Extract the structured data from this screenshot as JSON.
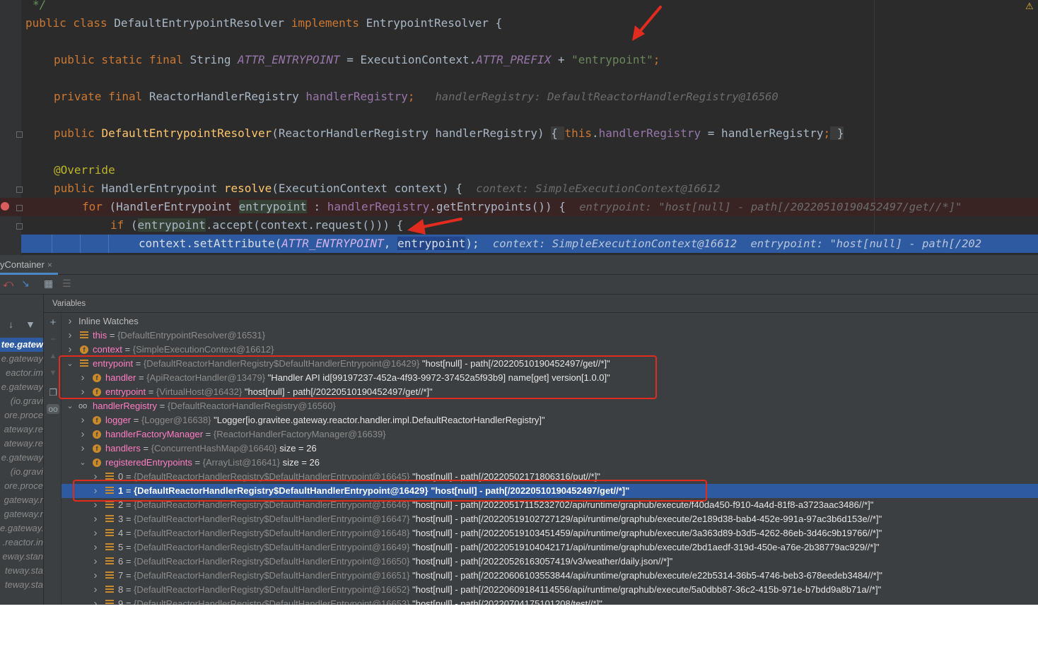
{
  "editor": {
    "comment_end": "*/",
    "lines": {
      "class_decl": {
        "kw1": "public class ",
        "name": "DefaultEntrypointResolver",
        "kw2": " implements ",
        "iface": "EntrypointResolver {"
      },
      "attr_field": {
        "kw": "public static final ",
        "type": "String ",
        "name": "ATTR_ENTRYPOINT",
        "mid": " = ExecutionContext.",
        "prefix": "ATTR_PREFIX",
        "plus": " + ",
        "str": "\"entrypoint\"",
        "end": ";"
      },
      "registry_field": {
        "kw": "private final ",
        "type": "ReactorHandlerRegistry ",
        "name": "handlerRegistry",
        "end": ";",
        "hint": "handlerRegistry: DefaultReactorHandlerRegistry@16560"
      },
      "constructor": {
        "kw": "public ",
        "name": "DefaultEntrypointResolver",
        "params": "(ReactorHandlerRegistry handlerRegistry) ",
        "ob": "{ ",
        "this_kw": "this",
        "dot": ".",
        "fld": "handlerRegistry",
        "assign": " = handlerRegistry",
        "semi": ";",
        "cb": " }"
      },
      "override": "@Override",
      "resolve": {
        "kw": "public ",
        "type": "HandlerEntrypoint ",
        "name": "resolve",
        "params": "(ExecutionContext context) {",
        "hint": "context: SimpleExecutionContext@16612"
      },
      "for_loop": {
        "kw": "for ",
        "open": "(HandlerEntrypoint ",
        "var": "entrypoint",
        "colon": " : ",
        "fld": "handlerRegistry",
        "call": ".getEntrypoints()) {",
        "hint": "entrypoint: \"host[null] - path[/20220510190452497/get//*]\""
      },
      "if_stmt": {
        "kw": "if ",
        "open": "(",
        "var": "entrypoint",
        "rest": ".accept(context.request())) {"
      },
      "exec": {
        "pre": "context.setAttribute(",
        "const": "ATTR_ENTRYPOINT",
        "comma": ", ",
        "var": "entrypoint",
        "end": ");",
        "hint1": "context: SimpleExecutionContext@16612",
        "hint2": "entrypoint: \"host[null] - path[/202"
      }
    }
  },
  "debugger": {
    "tab_label": "yContainer",
    "tab_close": "×",
    "variables_label": "Variables",
    "frames": [
      {
        "label": "tee.gatew",
        "selected": true
      },
      {
        "label": "e.gateway"
      },
      {
        "label": "eactor.im"
      },
      {
        "label": "e.gateway"
      },
      {
        "label": "(io.gravi"
      },
      {
        "label": "ore.proce"
      },
      {
        "label": "ateway.re"
      },
      {
        "label": "ateway.re"
      },
      {
        "label": "e.gateway"
      },
      {
        "label": "(io.gravi"
      },
      {
        "label": "ore.proce"
      },
      {
        "label": "gateway.r"
      },
      {
        "label": "gateway.r"
      },
      {
        "label": "e.gateway."
      },
      {
        "label": ".reactor.in"
      },
      {
        "label": "eway.stan"
      },
      {
        "label": "teway.sta"
      },
      {
        "label": "teway.sta"
      }
    ],
    "variables": [
      {
        "depth": 0,
        "chev": ">",
        "icon": "none",
        "name": "Inline Watches",
        "plain": true,
        "type": "",
        "value": ""
      },
      {
        "depth": 0,
        "chev": ">",
        "icon": "list",
        "name": "this",
        "type": "{DefaultEntrypointResolver@16531}",
        "value": ""
      },
      {
        "depth": 0,
        "chev": ">",
        "icon": "field",
        "name": "context",
        "type": "{SimpleExecutionContext@16612}",
        "value": ""
      },
      {
        "depth": 0,
        "chev": "v",
        "icon": "list",
        "name": "entrypoint",
        "type": "{DefaultReactorHandlerRegistry$DefaultHandlerEntrypoint@16429}",
        "value": "\"host[null] - path[/20220510190452497/get//*]\""
      },
      {
        "depth": 1,
        "chev": ">",
        "icon": "field",
        "name": "handler",
        "type": "{ApiReactorHandler@13479}",
        "value": "\"Handler API id[99197237-452a-4f93-9972-37452a5f93b9] name[get] version[1.0.0]\""
      },
      {
        "depth": 1,
        "chev": ">",
        "icon": "field",
        "name": "entrypoint",
        "type": "{VirtualHost@16432}",
        "value": "\"host[null] - path[/20220510190452497/get//*]\""
      },
      {
        "depth": 0,
        "chev": "v",
        "icon": "glasses",
        "name": "handlerRegistry",
        "type": "{DefaultReactorHandlerRegistry@16560}",
        "value": ""
      },
      {
        "depth": 1,
        "chev": ">",
        "icon": "field",
        "name": "logger",
        "type": "{Logger@16638}",
        "value": "\"Logger[io.gravitee.gateway.reactor.handler.impl.DefaultReactorHandlerRegistry]\""
      },
      {
        "depth": 1,
        "chev": ">",
        "icon": "field",
        "name": "handlerFactoryManager",
        "type": "{ReactorHandlerFactoryManager@16639}",
        "value": ""
      },
      {
        "depth": 1,
        "chev": ">",
        "icon": "field",
        "name": "handlers",
        "type": "{ConcurrentHashMap@16640}",
        "value": "size = 26"
      },
      {
        "depth": 1,
        "chev": "v",
        "icon": "field",
        "name": "registeredEntrypoints",
        "type": "{ArrayList@16641}",
        "value": "size = 26"
      },
      {
        "depth": 2,
        "chev": ">",
        "icon": "list",
        "name": "0",
        "type": "{DefaultReactorHandlerRegistry$DefaultHandlerEntrypoint@16645}",
        "value": "\"host[null] - path[/20220502171806316/put//*]\""
      },
      {
        "depth": 2,
        "chev": ">",
        "icon": "list",
        "name": "1",
        "type": "{DefaultReactorHandlerRegistry$DefaultHandlerEntrypoint@16429}",
        "value": "\"host[null] - path[/20220510190452497/get//*]\"",
        "selected": true
      },
      {
        "depth": 2,
        "chev": ">",
        "icon": "list",
        "name": "2",
        "type": "{DefaultReactorHandlerRegistry$DefaultHandlerEntrypoint@16646}",
        "value": "\"host[null] - path[/20220517115232702/api/runtime/graphub/execute/f40da450-f910-4a4d-81f8-a3723aac3486//*]\""
      },
      {
        "depth": 2,
        "chev": ">",
        "icon": "list",
        "name": "3",
        "type": "{DefaultReactorHandlerRegistry$DefaultHandlerEntrypoint@16647}",
        "value": "\"host[null] - path[/20220519102727129/api/runtime/graphub/execute/2e189d38-bab4-452e-991a-97ac3b6d153e//*]\""
      },
      {
        "depth": 2,
        "chev": ">",
        "icon": "list",
        "name": "4",
        "type": "{DefaultReactorHandlerRegistry$DefaultHandlerEntrypoint@16648}",
        "value": "\"host[null] - path[/20220519103451459/api/runtime/graphub/execute/3a363d89-b3d5-4262-86eb-3d46c9b19766//*]\""
      },
      {
        "depth": 2,
        "chev": ">",
        "icon": "list",
        "name": "5",
        "type": "{DefaultReactorHandlerRegistry$DefaultHandlerEntrypoint@16649}",
        "value": "\"host[null] - path[/20220519104042171/api/runtime/graphub/execute/2bd1aedf-319d-450e-a76e-2b38779ac929//*]\""
      },
      {
        "depth": 2,
        "chev": ">",
        "icon": "list",
        "name": "6",
        "type": "{DefaultReactorHandlerRegistry$DefaultHandlerEntrypoint@16650}",
        "value": "\"host[null] - path[/20220526163057419/v3/weather/daily.json//*]\""
      },
      {
        "depth": 2,
        "chev": ">",
        "icon": "list",
        "name": "7",
        "type": "{DefaultReactorHandlerRegistry$DefaultHandlerEntrypoint@16651}",
        "value": "\"host[null] - path[/20220606103553844/api/runtime/graphub/execute/e22b5314-36b5-4746-beb3-678eedeb3484//*]\""
      },
      {
        "depth": 2,
        "chev": ">",
        "icon": "list",
        "name": "8",
        "type": "{DefaultReactorHandlerRegistry$DefaultHandlerEntrypoint@16652}",
        "value": "\"host[null] - path[/20220609184114556/api/runtime/graphub/execute/5a0dbb87-36c2-415b-971e-b7bdd9a8b71a//*]\""
      },
      {
        "depth": 2,
        "chev": ">",
        "icon": "list",
        "name": "9",
        "type": "{DefaultReactorHandlerRegistry$DefaultHandlerEntrypoint@16653}",
        "value": "\"host[null] - path[/20220704175101208/test//*]\""
      }
    ]
  },
  "colors": {
    "editor_bg": "#2b2b2b",
    "debugger_bg": "#3c3f41",
    "selection": "#2d5aa0",
    "annotation_red": "#e22b1f"
  }
}
